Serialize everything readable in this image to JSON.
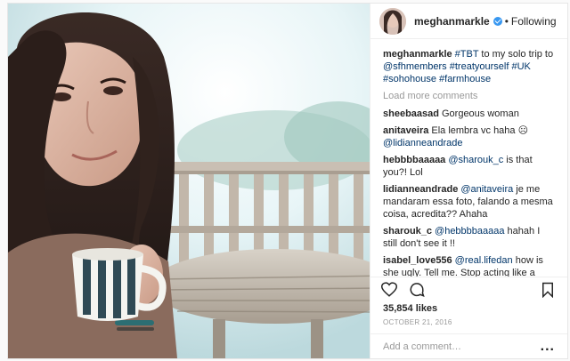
{
  "post": {
    "username": "meghanmarkle",
    "follow_status": "Following",
    "separator": "•",
    "caption_user": "meghanmarkle",
    "caption_parts": [
      {
        "text": "#TBT",
        "kind": "tag"
      },
      {
        "text": " to my solo trip to ",
        "kind": "text"
      },
      {
        "text": "@sfhmembers",
        "kind": "tag"
      },
      {
        "text": " ",
        "kind": "text"
      },
      {
        "text": "#treatyourself",
        "kind": "tag"
      },
      {
        "text": " ",
        "kind": "text"
      },
      {
        "text": "#UK",
        "kind": "tag"
      },
      {
        "text": " ",
        "kind": "text"
      },
      {
        "text": "#sohohouse",
        "kind": "tag"
      },
      {
        "text": " ",
        "kind": "text"
      },
      {
        "text": "#farmhouse",
        "kind": "tag"
      }
    ],
    "load_more": "Load more comments",
    "likes": "35,854 likes",
    "date": "OCTOBER 21, 2016",
    "add_comment_placeholder": "Add a comment…",
    "more_options": "...",
    "icons": [
      "heart-icon",
      "comment-icon",
      "bookmark-icon",
      "verified-icon"
    ]
  },
  "comments": [
    {
      "user": "sheebaasad",
      "parts": [
        {
          "text": "Gorgeous woman",
          "kind": "text"
        }
      ]
    },
    {
      "user": "anitaveira",
      "parts": [
        {
          "text": "Ela lembra vc haha ☹ ",
          "kind": "text"
        },
        {
          "text": "@lidianneandrade",
          "kind": "tag"
        }
      ]
    },
    {
      "user": "hebbbbaaaaa",
      "parts": [
        {
          "text": "@sharouk_c",
          "kind": "tag"
        },
        {
          "text": " is that you?! Lol",
          "kind": "text"
        }
      ]
    },
    {
      "user": "lidianneandrade",
      "parts": [
        {
          "text": "@anitaveira",
          "kind": "tag"
        },
        {
          "text": " je me mandaram essa foto, falando a mesma coisa, acredita?? Ahaha",
          "kind": "text"
        }
      ]
    },
    {
      "user": "sharouk_c",
      "parts": [
        {
          "text": "@hebbbbaaaaa",
          "kind": "tag"
        },
        {
          "text": " hahah I still don't see it !!",
          "kind": "text"
        }
      ]
    },
    {
      "user": "isabel_love556",
      "parts": [
        {
          "text": "@real.lifedan",
          "kind": "tag"
        },
        {
          "text": " how is she ugly. Tell me. Stop acting like a bitch and leave this woman alone. Sit your ugly ass down and stop bitching because harry fell in love with Meagan",
          "kind": "text"
        }
      ]
    }
  ],
  "colors": {
    "link": "#003569",
    "meta": "#999999",
    "verified": "#3897f0",
    "border": "#efefef"
  }
}
